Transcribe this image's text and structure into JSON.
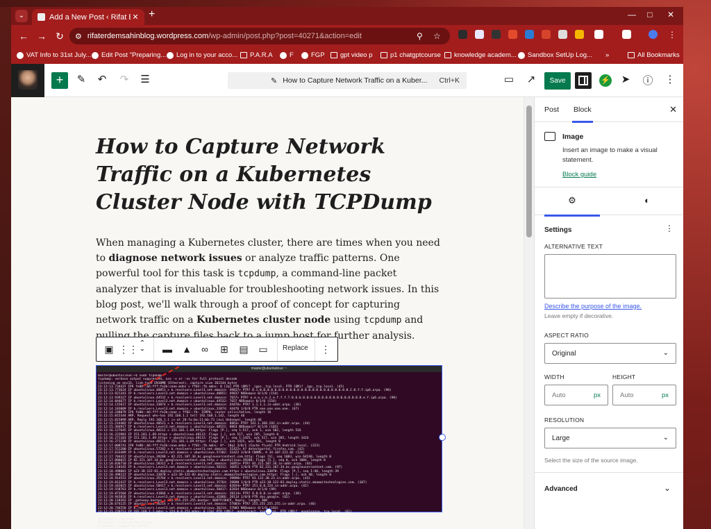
{
  "browser": {
    "tab_title": "Add a New Post ‹ Rifat Erdem S",
    "new_tab": "+",
    "url_host": "rifaterdemsahinblog.wordpress.com",
    "url_path": "/wp-admin/post.php?post=40271&action=edit",
    "bookmarks": [
      "VAT Info to 31st July...",
      "Edit Post \"Preparing...",
      "Log in to your acco...",
      "P.A.R.A",
      "F",
      "FGP",
      "gpt video p",
      "p1 chatgptcourse",
      "knowledge academ...",
      "Sandbox SetUp Log...",
      "»",
      "All Bookmarks"
    ]
  },
  "wp_toolbar": {
    "command_label": "How to Capture Network Traffic on a Kuber...",
    "command_shortcut": "Ctrl+K",
    "save_label": "Save"
  },
  "post": {
    "title": "How to Capture Network Traffic on a Kubernetes Cluster Node with TCPDump",
    "para": [
      {
        "t": "When managing a Kubernetes cluster, there are times when you need to "
      },
      {
        "b": "diagnose network issues"
      },
      {
        "t": " or analyze traffic patterns. One powerful tool for this task is "
      },
      {
        "c": "tcpdump"
      },
      {
        "t": ", a command-line packet analyzer that is invaluable for troubleshooting network issues. In this blog post, we'll walk through a proof of concept for capturing network traffic on a "
      },
      {
        "b": "Kubernetes cluster node"
      },
      {
        "t": " using "
      },
      {
        "c": "tcpdump"
      },
      {
        "t": " and pulling the capture files back to a jump host for further analysis."
      }
    ]
  },
  "block_toolbar": {
    "replace_label": "Replace"
  },
  "terminal": {
    "title": "master@ubuntulinux: ~",
    "lines": [
      "master@ubuntulinux:~$ sudo tcpdump",
      "tcpdump: verbose output suppressed, use -v or -vv for full protocol decode",
      "listening on ens33, link-type EN10MB (Ethernet), capture size 262144 bytes",
      "23:12:13.734437 IP6 fe80::b6:fff:fe2b:ceae.mdns > ff02::fb.mdns: 0 [2q] PTR (QM)? _ipps._tcp.local. PTR (QM)? _ipp._tcp.local. (45)",
      "23:12:13.773624 IP ubuntulinux.48851 > b.resolvers.Level3.net.domain: 49837+ PTR? 8.1.0.0.0.0.0.0.0.0.0.0.0.0.0.0.0.0.0.0.0.0.0.0.0.0.2.0.f.f.ip6.arpa. (90)",
      "23:12:13.921341 IP b.resolvers.Level3.net.domain > ubuntulinux.48851: 49837 NXDomain 0/1/0 (154)",
      "23:12:13.939327 IP ubuntulinux.44532 > b.resolvers.Level3.net.domain: 7657+ PTR? e.a.e.c.b.2.e.f.f.f.7.0.6.b.0.0.0.0.0.0.0.0.0.0.0.0.0.0.0.8.e.f.ip6.arpa. (90)",
      "23:12:14.044677 IP b.resolvers.Level3.net.domain > ubuntulinux.44532: 7657 NXDomain 0/1/0 (154)",
      "23:12:14.115617 IP ubuntulinux.33874 > b.resolvers.Level3.net.domain: 44476+ PTR? 1.1.1.1.in-addr.arpa. (38)",
      "23:12:14.183009 IP b.resolvers.Level3.net.domain > ubuntulinux.33874: 44476 1/0/0 PTR one.one.one.one. (67)",
      "23:12:14.248879 IP6 fe80::b6:fff:fe2b:ceae > ff02::fb: ICMP6, router solicitation, length 16",
      "23:12:15.015344 ARP, Request who-has 192.168.1.1 tell 192.168.1.142, length 46",
      "23:12:15.015899 ARP, Reply 192.168.1.1 is-at 28:fa:0a:11:bb:73 (oui Unknown), length 46",
      "23:12:15.214402 IP ubuntulinux.40521 > b.resolvers.Level3.net.domain: 8863+ PTR? 142.1.168.192.in-addr.arpa. (44)",
      "23:12:15.384917 IP b.resolvers.Level3.net.domain > ubuntulinux.40521: 8863 NXDomain* 0/1/0 (103)",
      "23:12:16.127645 IP ubuntulinux.48112 > 151.101.1.69.https: Flags [P.], seq 1:517, ack 1, win 502, length 516",
      "23:12:16.223901 IP 151.101.1.69.https > ubuntulinux.48112: Flags [.], ack 517, win 285, length 0",
      "23:12:16.271103 IP 151.101.1.69.https > ubuntulinux.48112: Flags [P.], seq 1:1425, ack 517, win 285, length 1424",
      "23:12:16.271238 IP ubuntulinux.48112 > 151.101.1.69.https: Flags [.], ack 1425, win 501, length 0",
      "23:12:17.008741 IP6 fe80::b6:fff:fe2b:ceae.mdns > ff02::fb.mdns: 0*- [0q] 3/0/1 (Cache flush) PTR Android.local. (223)",
      "23:12:17.551200 IP ubuntulinux.57202 > b.resolvers.Level3.net.domain: 31422+ A? detectportal.firefox.com. (42)",
      "23:12:17.633489 IP b.resolvers.Level3.net.domain > ubuntulinux.57202: 31422 3/0/0 CNAME, A 34.107.221.82 (126)",
      "23:12:17.704412 IP ubuntulinux.39288 > 82.221.107.34.bc.googleusercontent.com.http: Flags [S], seq 1003, win 64240, length 0",
      "23:12:17.806015 IP 82.221.107.34.bc.googleusercontent.com.http > ubuntulinux.39288: Flags [S.], seq 0, ack 1004, length 0",
      "23:12:18.036710 IP ubuntulinux.58312 > b.resolvers.Level3.net.domain: 16851+ PTR? 82.221.107.34.in-addr.arpa. (44)",
      "23:12:18.110342 IP b.resolvers.Level3.net.domain > ubuntulinux.58312: 16851 1/0/0 PTR 82.221.107.34.bc.googleusercontent.com. (97)",
      "23:12:18.498001 IP a23-38-122-83.deploy.static.akamaitechnologies.com.https > ubuntulinux.33070: Flags [P.], seq 1:40, length 39",
      "23:12:18.498112 IP ubuntulinux.33070 > a23-38-122-83.deploy.static.akamaitechnologies.com.https: Flags [.], ack 40, length 0",
      "23:12:18.914552 IP ubuntulinux.35764 > b.resolvers.Level3.net.domain: 39090+ PTR? 83.122.38.23.in-addr.arpa. (43)",
      "23:12:19.012437 IP b.resolvers.Level3.net.domain > ubuntulinux.35764: 39090 1/0/0 PTR a23-38-122-83.deploy.static.akamaitechnologies.com. (107)",
      "23:12:19.442015 IP ubuntulinux.50417 > b.resolvers.Level3.net.domain: 62034+ PTR? 251.0.0.224.in-addr.arpa. (42)",
      "23:12:19.558761 IP b.resolvers.Level3.net.domain > ubuntulinux.50417: 62034 NXDomain 0/1/0 (99)",
      "23:12:19.873504 IP ubuntulinux.41866 > b.resolvers.Level3.net.domain: 20114+ PTR? 8.8.8.8.in-addr.arpa. (38)",
      "23:12:19.943826 IP b.resolvers.Level3.net.domain > ubuntulinux.41866: 20114 1/0/0 PTR dns.google. (62)",
      "23:12:20.118263 IP _gateway.bootps > 255.255.255.255.bootpc: BOOTP/DHCP, Reply, length 300",
      "23:12:20.674125 IP ubuntulinux.36214 > b.resolvers.Level3.net.domain: 57003+ PTR? 255.255.255.255.in-addr.arpa. (46)",
      "23:12:20.746558 IP b.resolvers.Level3.net.domain > ubuntulinux.36214: 57003 NXDomain 0/1/0 (103)",
      "23:12:21.220711 IP 192.168.1.1.mdns > 224.0.0.251.mdns: 0 [2q] PTR (QM)? _googlecast._tcp.local. PTR (QM)? _googlezone._tcp.local. (61)",
      "",
      "39 packets captured",
      "44 packets received by filter",
      "0 packets dropped by kernel",
      "master@ubuntulinux:~$ "
    ]
  },
  "sidebar": {
    "tab_post": "Post",
    "tab_block": "Block",
    "block_name": "Image",
    "block_desc": "Insert an image to make a visual statement.",
    "block_guide": "Block guide",
    "settings_title": "Settings",
    "alt_label": "ALTERNATIVE TEXT",
    "alt_value": "",
    "alt_link": "Describe the purpose of the image.",
    "alt_help": "Leave empty if decorative.",
    "aspect_label": "ASPECT RATIO",
    "aspect_value": "Original",
    "width_label": "WIDTH",
    "height_label": "HEIGHT",
    "width_placeholder": "Auto",
    "height_placeholder": "Auto",
    "unit": "px",
    "resolution_label": "RESOLUTION",
    "resolution_value": "Large",
    "resolution_help": "Select the size of the source image.",
    "advanced_label": "Advanced"
  },
  "colors": {
    "browser_chrome": "#a31d1d",
    "wp_primary": "#067a4e",
    "wp_accent": "#3858e9",
    "terminal_bg": "#300a24",
    "annotation_arrow": "#e02b20"
  },
  "icons": [
    "tab-search-icon",
    "back-icon",
    "forward-icon",
    "reload-icon",
    "site-settings-icon",
    "zoom-icon",
    "star-icon",
    "add-block-icon",
    "pencil-icon",
    "undo-icon",
    "redo-icon",
    "document-overview-icon",
    "desktop-preview-icon",
    "external-view-icon",
    "settings-toggle-icon",
    "jetpack-icon",
    "send-icon",
    "help-icon",
    "options-icon",
    "image-icon",
    "gear-icon",
    "contrast-icon"
  ]
}
